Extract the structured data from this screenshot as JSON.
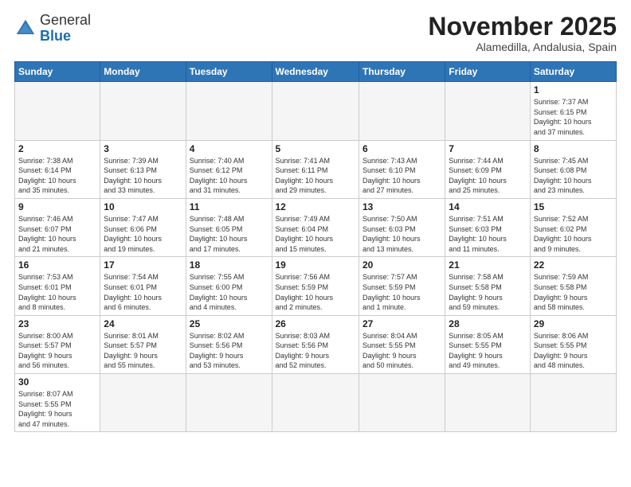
{
  "logo": {
    "general": "General",
    "blue": "Blue"
  },
  "title": "November 2025",
  "location": "Alamedilla, Andalusia, Spain",
  "weekdays": [
    "Sunday",
    "Monday",
    "Tuesday",
    "Wednesday",
    "Thursday",
    "Friday",
    "Saturday"
  ],
  "days": [
    {
      "num": "",
      "info": ""
    },
    {
      "num": "",
      "info": ""
    },
    {
      "num": "",
      "info": ""
    },
    {
      "num": "",
      "info": ""
    },
    {
      "num": "",
      "info": ""
    },
    {
      "num": "",
      "info": ""
    },
    {
      "num": "1",
      "info": "Sunrise: 7:37 AM\nSunset: 6:15 PM\nDaylight: 10 hours\nand 37 minutes."
    },
    {
      "num": "2",
      "info": "Sunrise: 7:38 AM\nSunset: 6:14 PM\nDaylight: 10 hours\nand 35 minutes."
    },
    {
      "num": "3",
      "info": "Sunrise: 7:39 AM\nSunset: 6:13 PM\nDaylight: 10 hours\nand 33 minutes."
    },
    {
      "num": "4",
      "info": "Sunrise: 7:40 AM\nSunset: 6:12 PM\nDaylight: 10 hours\nand 31 minutes."
    },
    {
      "num": "5",
      "info": "Sunrise: 7:41 AM\nSunset: 6:11 PM\nDaylight: 10 hours\nand 29 minutes."
    },
    {
      "num": "6",
      "info": "Sunrise: 7:43 AM\nSunset: 6:10 PM\nDaylight: 10 hours\nand 27 minutes."
    },
    {
      "num": "7",
      "info": "Sunrise: 7:44 AM\nSunset: 6:09 PM\nDaylight: 10 hours\nand 25 minutes."
    },
    {
      "num": "8",
      "info": "Sunrise: 7:45 AM\nSunset: 6:08 PM\nDaylight: 10 hours\nand 23 minutes."
    },
    {
      "num": "9",
      "info": "Sunrise: 7:46 AM\nSunset: 6:07 PM\nDaylight: 10 hours\nand 21 minutes."
    },
    {
      "num": "10",
      "info": "Sunrise: 7:47 AM\nSunset: 6:06 PM\nDaylight: 10 hours\nand 19 minutes."
    },
    {
      "num": "11",
      "info": "Sunrise: 7:48 AM\nSunset: 6:05 PM\nDaylight: 10 hours\nand 17 minutes."
    },
    {
      "num": "12",
      "info": "Sunrise: 7:49 AM\nSunset: 6:04 PM\nDaylight: 10 hours\nand 15 minutes."
    },
    {
      "num": "13",
      "info": "Sunrise: 7:50 AM\nSunset: 6:03 PM\nDaylight: 10 hours\nand 13 minutes."
    },
    {
      "num": "14",
      "info": "Sunrise: 7:51 AM\nSunset: 6:03 PM\nDaylight: 10 hours\nand 11 minutes."
    },
    {
      "num": "15",
      "info": "Sunrise: 7:52 AM\nSunset: 6:02 PM\nDaylight: 10 hours\nand 9 minutes."
    },
    {
      "num": "16",
      "info": "Sunrise: 7:53 AM\nSunset: 6:01 PM\nDaylight: 10 hours\nand 8 minutes."
    },
    {
      "num": "17",
      "info": "Sunrise: 7:54 AM\nSunset: 6:01 PM\nDaylight: 10 hours\nand 6 minutes."
    },
    {
      "num": "18",
      "info": "Sunrise: 7:55 AM\nSunset: 6:00 PM\nDaylight: 10 hours\nand 4 minutes."
    },
    {
      "num": "19",
      "info": "Sunrise: 7:56 AM\nSunset: 5:59 PM\nDaylight: 10 hours\nand 2 minutes."
    },
    {
      "num": "20",
      "info": "Sunrise: 7:57 AM\nSunset: 5:59 PM\nDaylight: 10 hours\nand 1 minute."
    },
    {
      "num": "21",
      "info": "Sunrise: 7:58 AM\nSunset: 5:58 PM\nDaylight: 9 hours\nand 59 minutes."
    },
    {
      "num": "22",
      "info": "Sunrise: 7:59 AM\nSunset: 5:58 PM\nDaylight: 9 hours\nand 58 minutes."
    },
    {
      "num": "23",
      "info": "Sunrise: 8:00 AM\nSunset: 5:57 PM\nDaylight: 9 hours\nand 56 minutes."
    },
    {
      "num": "24",
      "info": "Sunrise: 8:01 AM\nSunset: 5:57 PM\nDaylight: 9 hours\nand 55 minutes."
    },
    {
      "num": "25",
      "info": "Sunrise: 8:02 AM\nSunset: 5:56 PM\nDaylight: 9 hours\nand 53 minutes."
    },
    {
      "num": "26",
      "info": "Sunrise: 8:03 AM\nSunset: 5:56 PM\nDaylight: 9 hours\nand 52 minutes."
    },
    {
      "num": "27",
      "info": "Sunrise: 8:04 AM\nSunset: 5:55 PM\nDaylight: 9 hours\nand 50 minutes."
    },
    {
      "num": "28",
      "info": "Sunrise: 8:05 AM\nSunset: 5:55 PM\nDaylight: 9 hours\nand 49 minutes."
    },
    {
      "num": "29",
      "info": "Sunrise: 8:06 AM\nSunset: 5:55 PM\nDaylight: 9 hours\nand 48 minutes."
    },
    {
      "num": "30",
      "info": "Sunrise: 8:07 AM\nSunset: 5:55 PM\nDaylight: 9 hours\nand 47 minutes."
    },
    {
      "num": "",
      "info": ""
    },
    {
      "num": "",
      "info": ""
    },
    {
      "num": "",
      "info": ""
    },
    {
      "num": "",
      "info": ""
    },
    {
      "num": "",
      "info": ""
    },
    {
      "num": "",
      "info": ""
    }
  ]
}
